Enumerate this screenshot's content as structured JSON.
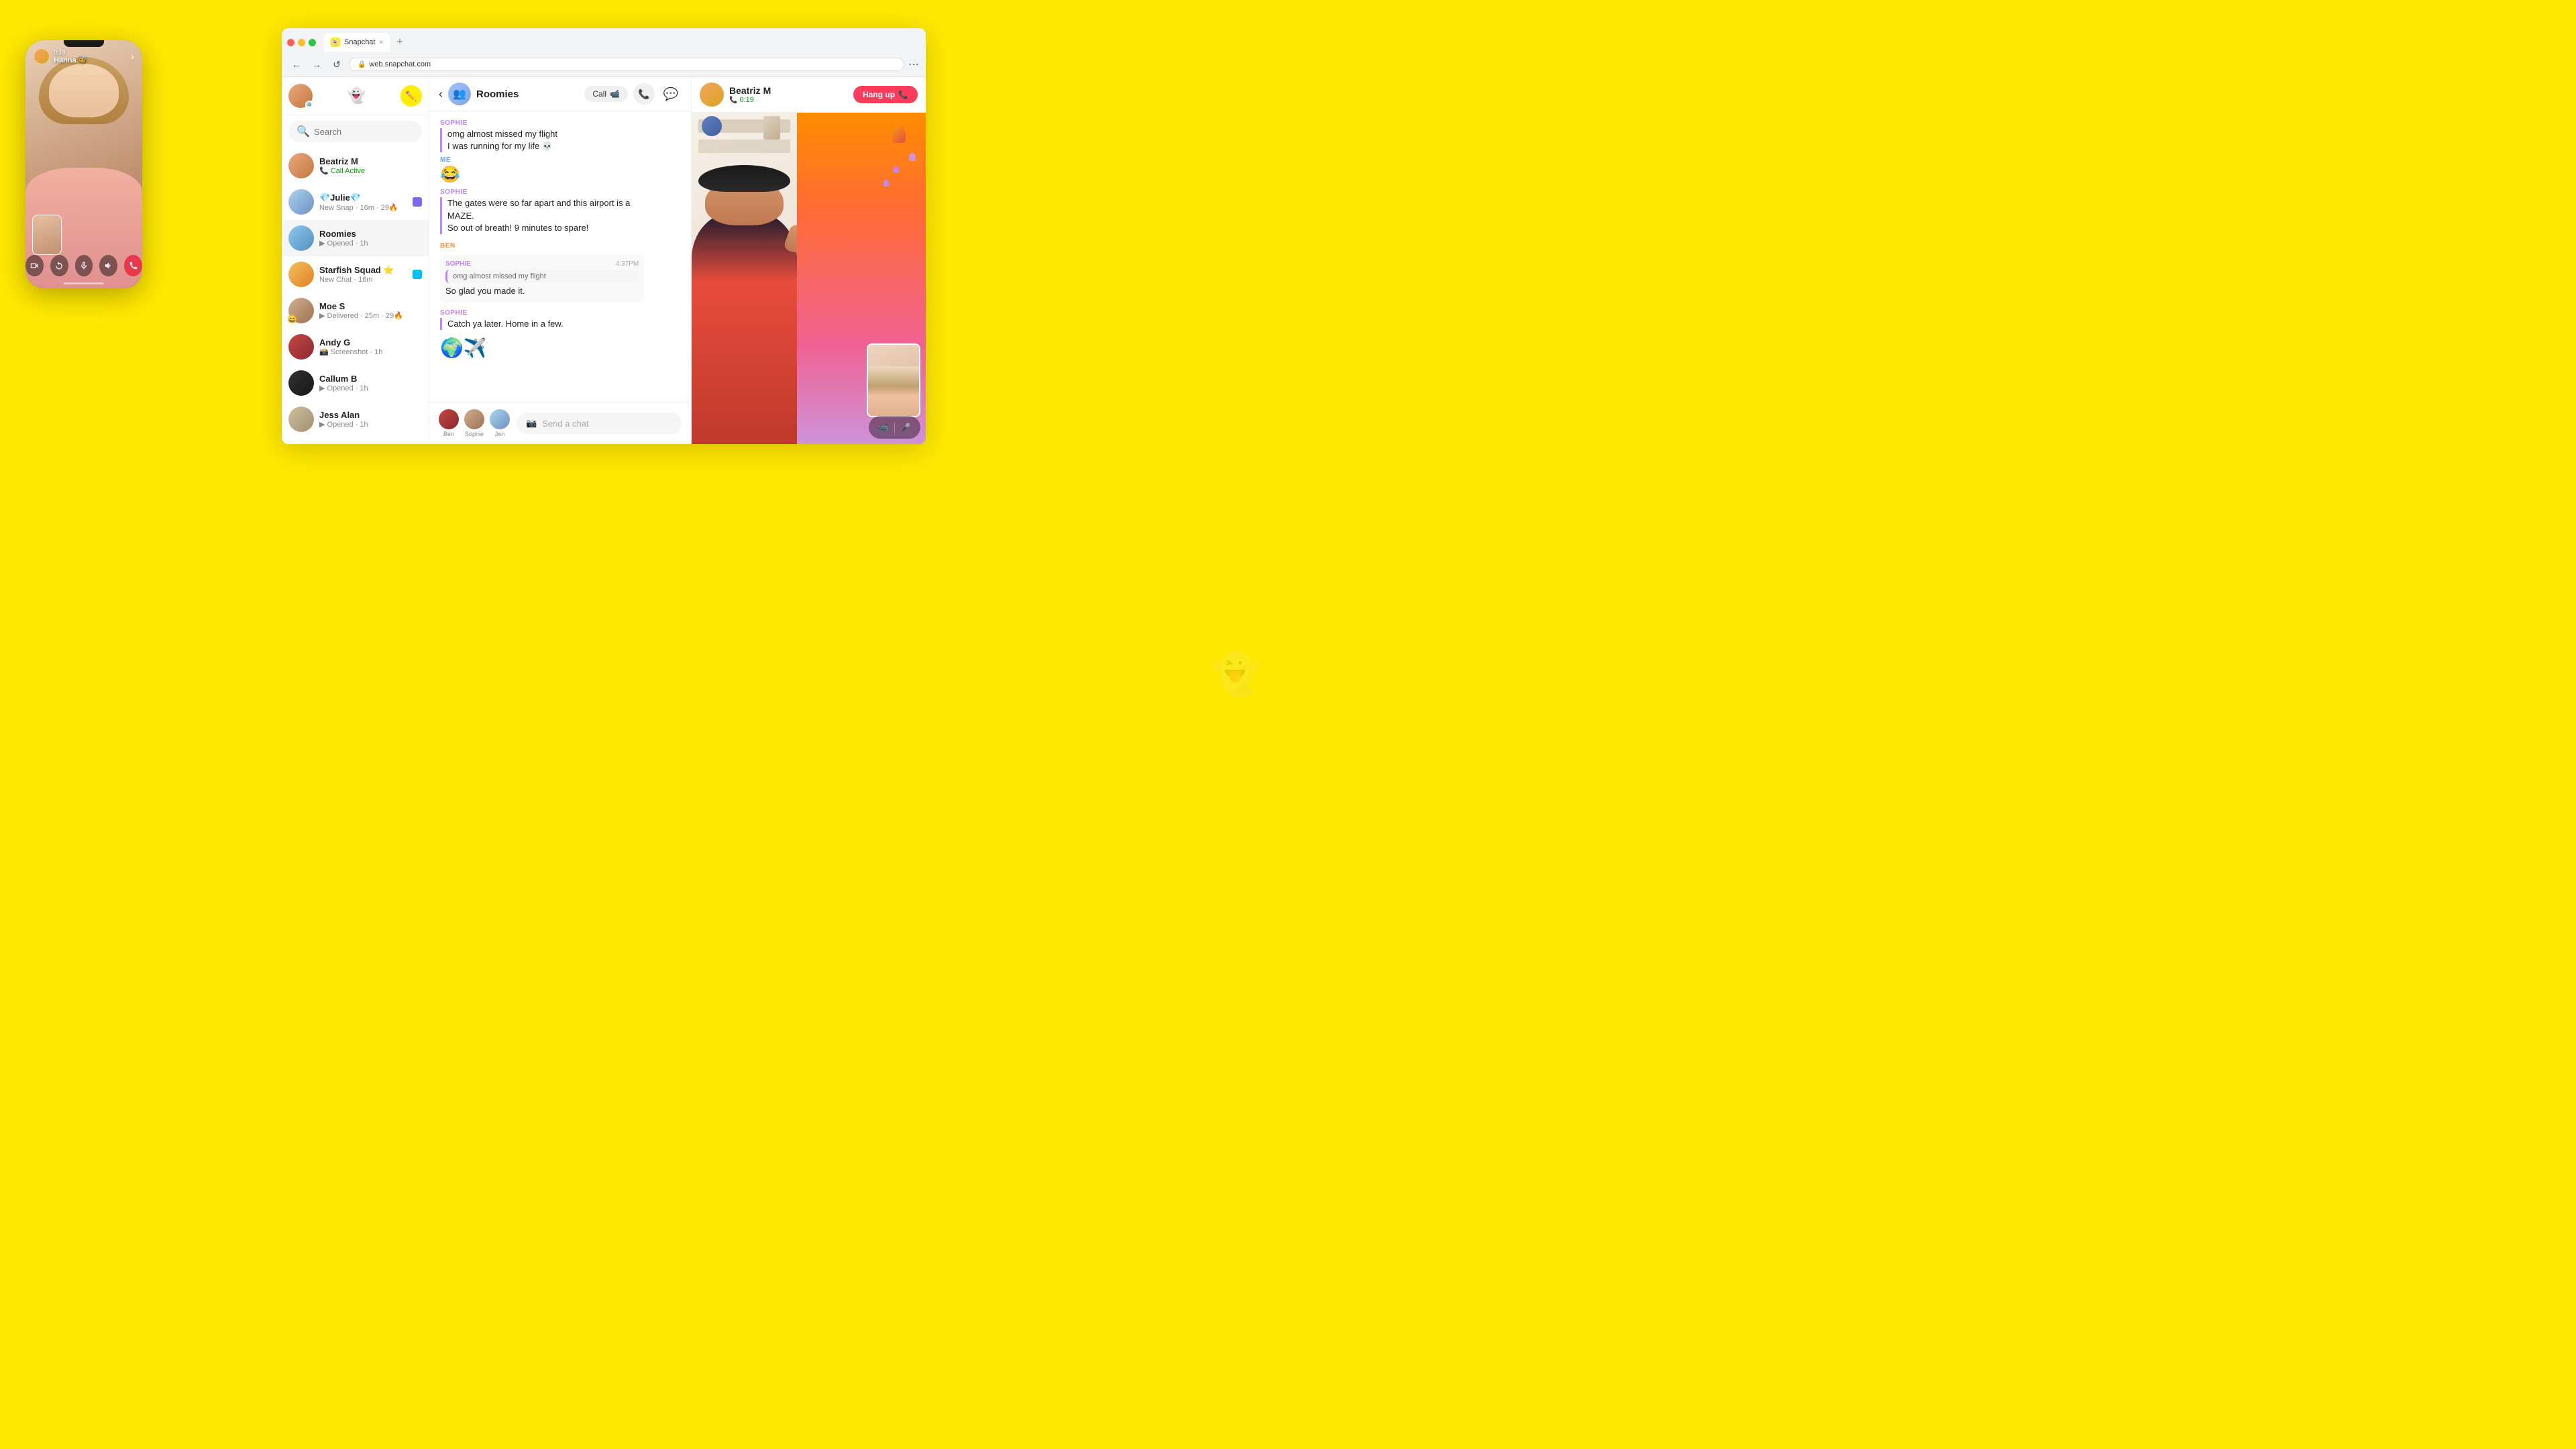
{
  "page": {
    "background_color": "#FFE800"
  },
  "phone": {
    "timer": "0:19",
    "caller_name": "Hanna 🐝",
    "controls": [
      "camera-off",
      "rotate",
      "mute",
      "speaker",
      "end-call"
    ]
  },
  "browser": {
    "tab_title": "Snapchat",
    "url": "web.snapchat.com",
    "new_tab_label": "+",
    "close_label": "×",
    "nav": {
      "back": "←",
      "forward": "→",
      "refresh": "↺",
      "more": "⋯"
    }
  },
  "sidebar": {
    "search_placeholder": "Search",
    "contacts": [
      {
        "name": "Beatriz M",
        "status": "Call Active",
        "status_type": "active_call",
        "avatar_class": "av-beatriz"
      },
      {
        "name": "💎Julie💎",
        "status": "New Snap · 16m · 29🔥",
        "status_type": "new_snap",
        "avatar_class": "av-julie",
        "badge": "purple"
      },
      {
        "name": "Roomies",
        "status": "▶ Opened · 1h",
        "status_type": "opened",
        "avatar_class": "av-roomies",
        "active": true
      },
      {
        "name": "Starfish Squad ⭐",
        "status": "New Chat · 16m",
        "status_type": "new_chat",
        "avatar_class": "av-starfish",
        "badge": "cyan"
      },
      {
        "name": "Moe S",
        "status": "▶ Delivered · 25m · 29🔥",
        "status_type": "delivered",
        "avatar_class": "av-moe"
      },
      {
        "name": "Andy G",
        "status": "📸 Screenshot · 1h",
        "status_type": "screenshot",
        "avatar_class": "av-andy"
      },
      {
        "name": "Callum B",
        "status": "▶ Opened · 1h",
        "status_type": "opened",
        "avatar_class": "av-callum"
      },
      {
        "name": "Jess Alan",
        "status": "▶ Opened · 1h",
        "status_type": "opened",
        "avatar_class": "av-jess"
      }
    ]
  },
  "chat": {
    "title": "Roomies",
    "call_btn": "Call",
    "messages": [
      {
        "sender": "SOPHIE",
        "sender_class": "sophie",
        "text": "omg almost missed my flight\nI was running for my life 💀",
        "type": "text"
      },
      {
        "sender": "ME",
        "sender_class": "me",
        "text": "😂",
        "type": "emoji"
      },
      {
        "sender": "SOPHIE",
        "sender_class": "sophie",
        "text": "The gates were so far apart and this airport is a MAZE.\nSo out of breath! 9 minutes to spare!",
        "type": "text"
      },
      {
        "sender": "BEN",
        "sender_class": "ben",
        "text": "",
        "type": "spacer"
      },
      {
        "sender": "SOPHIE",
        "sender_class": "sophie",
        "text": "omg almost missed my flight",
        "time": "4:37PM",
        "type": "quoted"
      },
      {
        "sender": "",
        "sender_class": "",
        "text": "So glad you made it.",
        "type": "plain"
      },
      {
        "sender": "SOPHIE",
        "sender_class": "sophie",
        "text": "Catch ya later. Home in a few.",
        "type": "text"
      },
      {
        "sender": "",
        "sender_class": "",
        "text": "🌍✈️",
        "type": "sticker"
      }
    ],
    "typing_users": [
      {
        "name": "Ben",
        "avatar_class": "av-andy"
      },
      {
        "name": "Sophie",
        "avatar_class": "av-moe"
      },
      {
        "name": "Jen",
        "avatar_class": "av-julie"
      }
    ],
    "input_placeholder": "Send a chat"
  },
  "video_call": {
    "caller_name": "Beatriz M",
    "timer": "0:19",
    "hang_up_label": "Hang up"
  },
  "snapchat_ghost": "👻"
}
